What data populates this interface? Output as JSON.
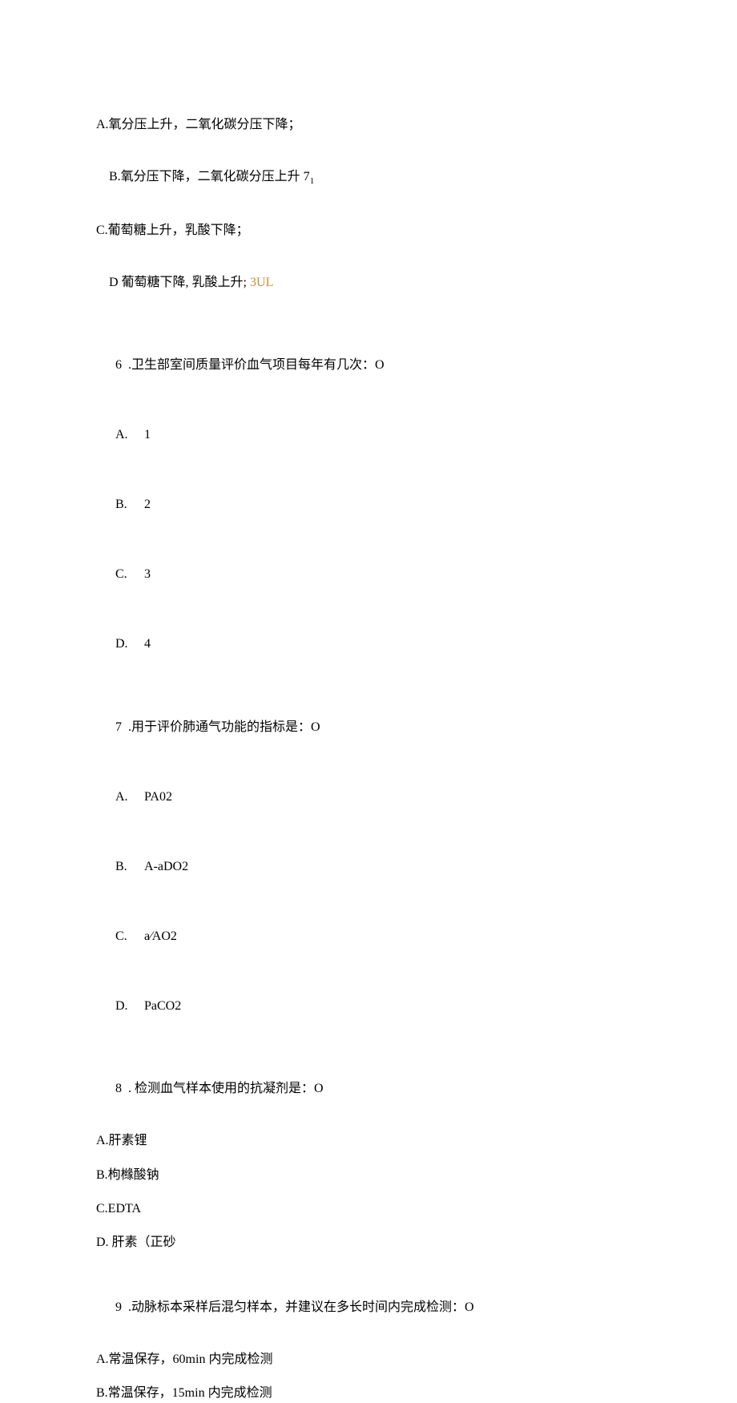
{
  "intro_options": {
    "a": "A.氧分压上升，二氧化碳分压下降；",
    "b_part1": "B.氧分压下降，二氧化碳分压上升 7",
    "b_sub": "1",
    "c": "C.葡萄糖上升，乳酸下降；",
    "d_part1": "D 葡萄糖下降, 乳酸上升; ",
    "d_orange": "3UL"
  },
  "q6": {
    "stem_num": "6  .",
    "stem_text": "卫生部室间质量评价血气项目每年有几次：O",
    "a_letter": "A.",
    "a_val": "1",
    "b_letter": "B.",
    "b_val": "2",
    "c_letter": "C.",
    "c_val": "3",
    "d_letter": "D.",
    "d_val": "4"
  },
  "q7": {
    "stem_num": "7  .",
    "stem_text": "用于评价肺通气功能的指标是：O",
    "a_letter": "A.",
    "a_val": "PA02",
    "b_letter": "B.",
    "b_val": "A-aDO2",
    "c_letter": "C.",
    "c_val": "a⁄AO2",
    "d_letter": "D.",
    "d_val": "PaCO2"
  },
  "q8": {
    "stem_num": "8  .",
    "stem_text": " 检测血气样本使用的抗凝剂是：O",
    "a": "A.肝素锂",
    "b": "B.枸橼酸钠",
    "c": "C.EDTA",
    "d": "D. 肝素（正砂"
  },
  "q9": {
    "stem_num": "9  .",
    "stem_text": "动脉标本采样后混匀样本，并建议在多长时间内完成检测：O",
    "a": "A.常温保存，60min 内完成检测",
    "b": "B.常温保存，15min 内完成检测"
  }
}
